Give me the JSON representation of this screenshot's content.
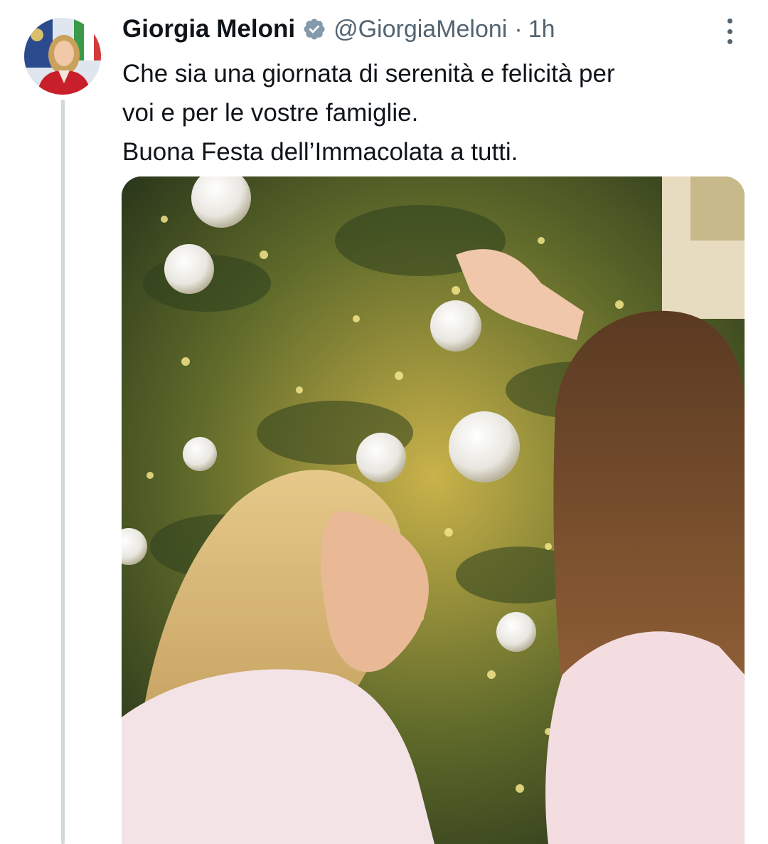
{
  "tweet": {
    "author": {
      "display_name": "Giorgia Meloni",
      "handle": "@GiorgiaMeloni",
      "verified": true,
      "verified_badge_color": "#829aab"
    },
    "separator": "·",
    "timestamp": "1h",
    "text_lines": [
      "Che sia una giornata di serenità e felicità per",
      "voi e per le vostre famiglie.",
      "Buona Festa dell’Immacolata a tutti."
    ],
    "media": {
      "type": "photo"
    }
  },
  "icons": {
    "avatar": "avatar",
    "verified": "verified-badge-icon",
    "more": "more-vertical-icon"
  },
  "colors": {
    "text_primary": "#0f1419",
    "text_secondary": "#536471",
    "thread_line": "#cfd9de"
  }
}
